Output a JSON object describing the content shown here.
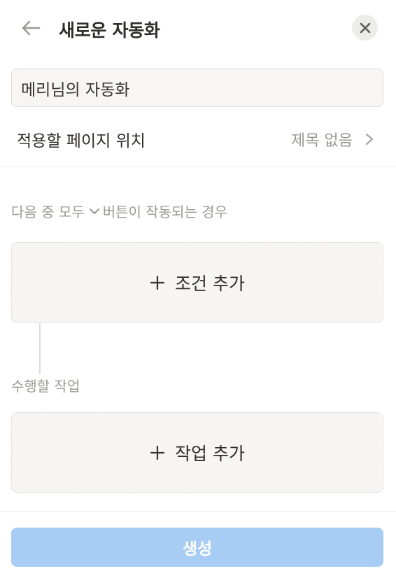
{
  "header": {
    "title": "새로운 자동화",
    "back_icon": "arrow-left-icon",
    "close_icon": "close-icon"
  },
  "name_input": {
    "value": "메리님의 자동화"
  },
  "location": {
    "label": "적용할 페이지 위치",
    "value": "제목 없음",
    "chevron_icon": "chevron-right-icon"
  },
  "trigger": {
    "prefix": "다음 중 모두",
    "suffix": "버튼이 작동되는 경우",
    "chevron_icon": "chevron-down-icon"
  },
  "condition_box": {
    "label": "조건 추가",
    "icon": "plus-icon"
  },
  "action_section": {
    "label": "수행할 작업"
  },
  "action_box": {
    "label": "작업 추가",
    "icon": "plus-icon"
  },
  "footer": {
    "create_label": "생성"
  },
  "colors": {
    "create_button_bg": "#a8cdf4",
    "muted_text": "#9b9a97",
    "box_bg": "#f6f5f2"
  }
}
